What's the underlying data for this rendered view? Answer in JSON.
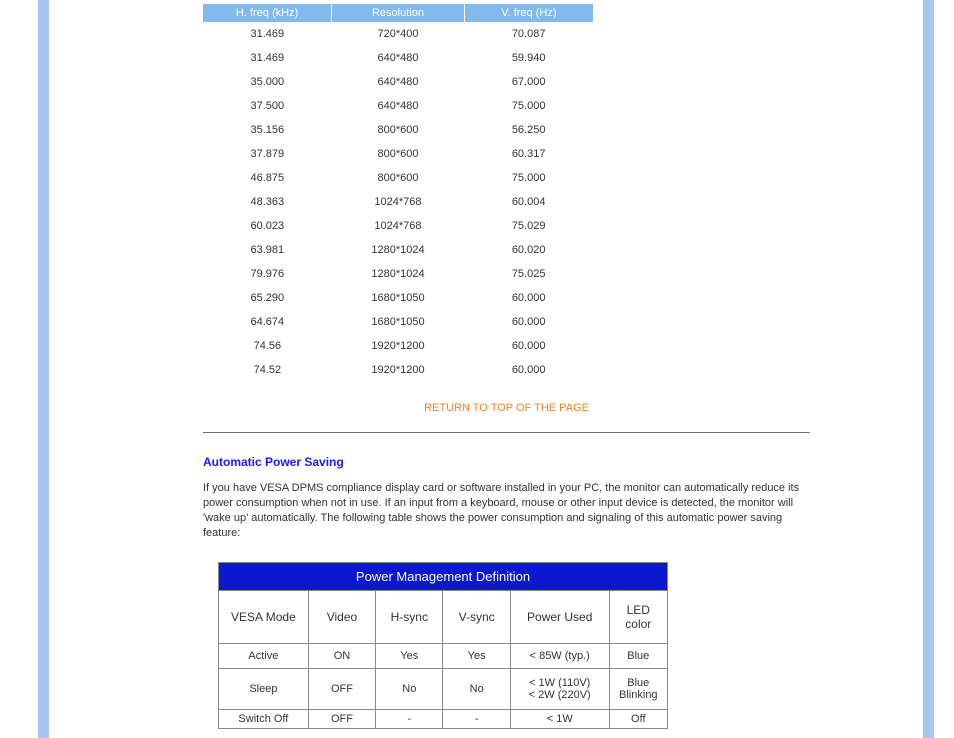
{
  "freq_table": {
    "headers": [
      "H. freq (kHz)",
      "Resolution",
      "V. freq (Hz)"
    ],
    "rows": [
      [
        "31.469",
        "720*400",
        "70.087"
      ],
      [
        "31.469",
        "640*480",
        "59.940"
      ],
      [
        "35.000",
        "640*480",
        "67.000"
      ],
      [
        "37.500",
        "640*480",
        "75.000"
      ],
      [
        "35.156",
        "800*600",
        "56.250"
      ],
      [
        "37.879",
        "800*600",
        "60.317"
      ],
      [
        "46.875",
        "800*600",
        "75.000"
      ],
      [
        "48.363",
        "1024*768",
        "60.004"
      ],
      [
        "60.023",
        "1024*768",
        "75.029"
      ],
      [
        "63.981",
        "1280*1024",
        "60.020"
      ],
      [
        "79.976",
        "1280*1024",
        "75.025"
      ],
      [
        "65.290",
        "1680*1050",
        "60.000"
      ],
      [
        "64.674",
        "1680*1050",
        "60.000"
      ],
      [
        "74.56",
        "1920*1200",
        "60.000"
      ],
      [
        "74.52",
        "1920*1200",
        "60.000"
      ]
    ]
  },
  "return_link": "RETURN TO TOP OF THE PAGE",
  "section_heading": "Automatic Power Saving",
  "body_text": "If you have VESA DPMS compliance display card or software installed in your PC, the monitor can automatically reduce its power consumption when not in use. If an input from a keyboard, mouse or other input device is detected, the monitor will 'wake up' automatically. The following table shows the power consumption and signaling of this automatic power saving feature:",
  "pm_table": {
    "title": "Power Management Definition",
    "headers": [
      "VESA Mode",
      "Video",
      "H-sync",
      "V-sync",
      "Power Used",
      "LED color"
    ],
    "rows": [
      [
        "Active",
        "ON",
        "Yes",
        "Yes",
        "< 85W (typ.)",
        "Blue"
      ],
      [
        "Sleep",
        "OFF",
        "No",
        "No",
        "< 1W (110V)\n< 2W (220V)",
        "Blue Blinking"
      ],
      [
        "Switch Off",
        "OFF",
        "-",
        "-",
        "< 1W",
        "Off"
      ]
    ]
  }
}
